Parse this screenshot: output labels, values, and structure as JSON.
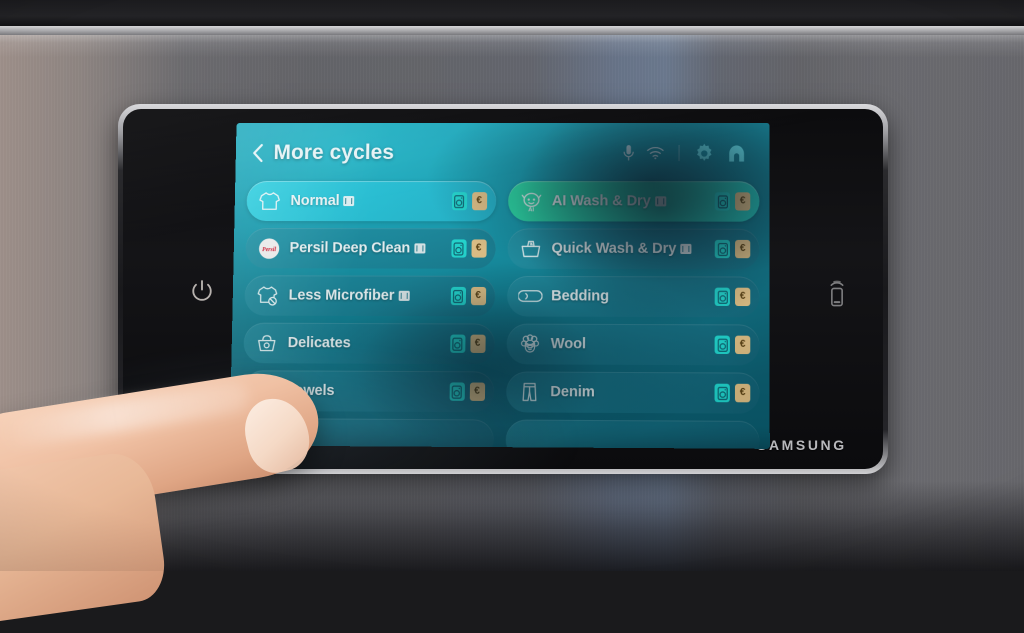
{
  "appliance": {
    "brand": "SAMSUNG",
    "power_button_icon": "power-icon",
    "nfc_icon": "nfc-tap-icon"
  },
  "header": {
    "back_icon": "chevron-left-icon",
    "title": "More cycles",
    "status_icons": [
      {
        "name": "microphone-icon",
        "label": "Voice"
      },
      {
        "name": "wifi-icon",
        "label": "Wi-Fi"
      },
      {
        "name": "settings-gear-icon",
        "label": "Settings"
      },
      {
        "name": "home-icon",
        "label": "Home"
      }
    ]
  },
  "colors": {
    "screen_teal": "#12a0b5",
    "tile_highlight_cyan": "#23c6dc",
    "tile_highlight_green": "#22d8b4",
    "tile_default": "#1c7e94",
    "badge_washer": "#1fe0d8",
    "badge_cost": "#e9c88a",
    "text": "#f2fdff"
  },
  "badges": {
    "washer_glyph": "◫",
    "cost_glyph": "€"
  },
  "cycles": {
    "left_column": [
      {
        "label": "Normal",
        "icon": "tshirt-icon",
        "highlight": "cyan",
        "ai_flag": true,
        "badges": [
          "washer",
          "cost"
        ]
      },
      {
        "label": "Persil Deep Clean",
        "icon": "persil-logo-icon",
        "highlight": "none",
        "ai_flag": true,
        "badges": [
          "washer",
          "cost"
        ]
      },
      {
        "label": "Less Microfiber",
        "icon": "tshirt-no-icon",
        "highlight": "none",
        "ai_flag": true,
        "badges": [
          "washer",
          "cost"
        ]
      },
      {
        "label": "Delicates",
        "icon": "handwash-basin-icon",
        "highlight": "none",
        "ai_flag": false,
        "badges": [
          "washer",
          "cost"
        ]
      },
      {
        "label": "Towels",
        "icon": "towel-icon",
        "highlight": "none",
        "ai_flag": false,
        "badges": [
          "washer",
          "cost"
        ],
        "occluded_by_finger": true
      },
      {
        "label": "",
        "icon": "",
        "highlight": "none",
        "ai_flag": false,
        "badges": [],
        "cut_off": true
      }
    ],
    "right_column": [
      {
        "label": "AI Wash & Dry",
        "icon": "ai-face-icon",
        "highlight": "green",
        "ai_flag": true,
        "badges": [
          "washer",
          "cost"
        ]
      },
      {
        "label": "Quick Wash & Dry",
        "icon": "quick-basin-icon",
        "highlight": "none",
        "ai_flag": true,
        "badges": [
          "washer",
          "cost"
        ]
      },
      {
        "label": "Bedding",
        "icon": "pillow-icon",
        "highlight": "none",
        "ai_flag": false,
        "badges": [
          "washer",
          "cost"
        ]
      },
      {
        "label": "Wool",
        "icon": "sheep-icon",
        "highlight": "none",
        "ai_flag": false,
        "badges": [
          "washer",
          "cost"
        ]
      },
      {
        "label": "Denim",
        "icon": "jeans-icon",
        "highlight": "none",
        "ai_flag": false,
        "badges": [
          "washer",
          "cost"
        ]
      },
      {
        "label": "",
        "icon": "",
        "highlight": "none",
        "ai_flag": false,
        "badges": [],
        "cut_off": true
      }
    ]
  },
  "persil_logo": {
    "text": "Persil"
  },
  "hand": {
    "description": "finger touching screen"
  }
}
